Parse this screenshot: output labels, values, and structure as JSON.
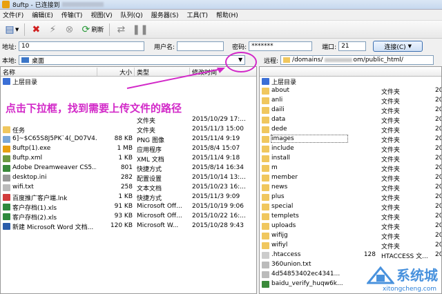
{
  "window": {
    "title": "8uftp - 已连接到 "
  },
  "menu": [
    "文件(F)",
    "编辑(E)",
    "传输(T)",
    "视图(V)",
    "队列(Q)",
    "服务器(S)",
    "工具(T)",
    "帮助(H)"
  ],
  "toolbar": {
    "refresh_label": "刷新"
  },
  "connection": {
    "address_label": "地址:",
    "address_value": "10",
    "user_label": "用户名:",
    "user_value": "",
    "password_label": "密码:",
    "password_value": "*******",
    "port_label": "端口:",
    "port_value": "21",
    "connect_label": "连接(C)"
  },
  "local": {
    "label": "本地:",
    "path": "桌面",
    "columns": [
      "名称",
      "大小",
      "类型",
      "修改时间"
    ],
    "rows": [
      {
        "name": "上层目录",
        "size": "",
        "type": "",
        "date": "",
        "icon": "up-icon",
        "color": "#3b6fd6"
      },
      {
        "name": "",
        "size": "",
        "type": "",
        "date": "",
        "icon": "",
        "color": ""
      },
      {
        "name": "",
        "size": "",
        "type": "",
        "date": "",
        "icon": "",
        "color": ""
      },
      {
        "name": "",
        "size": "",
        "type": "",
        "date": "",
        "icon": "",
        "color": ""
      },
      {
        "name": "",
        "size": "",
        "type": "文件夹",
        "date": "2015/10/29 17:...",
        "icon": "",
        "color": ""
      },
      {
        "name": "任务",
        "size": "",
        "type": "文件夹",
        "date": "2015/11/3 15:00",
        "icon": "folder-icon",
        "color": "#f0c75e"
      },
      {
        "name": "6]~$C65S8J5PK`4(_D07V4...",
        "size": "88 KB",
        "type": "PNG 图像",
        "date": "2015/11/4 9:19",
        "icon": "image-icon",
        "color": "#7aa7d8"
      },
      {
        "name": "8uftp(1).exe",
        "size": "1 MB",
        "type": "应用程序",
        "date": "2015/8/4 15:07",
        "icon": "exe-icon",
        "color": "#e8a010"
      },
      {
        "name": "8uftp.xml",
        "size": "1 KB",
        "type": "XML 文档",
        "date": "2015/11/4 9:18",
        "icon": "xml-icon",
        "color": "#6d9a40"
      },
      {
        "name": "Adobe Dreamweaver CS5...",
        "size": "801",
        "type": "快捷方式",
        "date": "2015/8/14 16:34",
        "icon": "dw-icon",
        "color": "#3a8a3a"
      },
      {
        "name": "desktop.ini",
        "size": "282",
        "type": "配置设置",
        "date": "2015/10/14 13:...",
        "icon": "ini-icon",
        "color": "#999999"
      },
      {
        "name": "wifi.txt",
        "size": "258",
        "type": "文本文档",
        "date": "2015/10/23 16:...",
        "icon": "txt-icon",
        "color": "#bbbbbb"
      },
      {
        "name": "百度推广客户端.lnk",
        "size": "1 KB",
        "type": "快捷方式",
        "date": "2015/11/3 9:09",
        "icon": "baidu-icon",
        "color": "#d23b3b"
      },
      {
        "name": "客户存档(1).xls",
        "size": "91 KB",
        "type": "Microsoft Off...",
        "date": "2015/10/19 9:06",
        "icon": "xls-icon",
        "color": "#2f8a3e"
      },
      {
        "name": "客户存档(2).xls",
        "size": "93 KB",
        "type": "Microsoft Off...",
        "date": "2015/10/22 16:...",
        "icon": "xls-icon",
        "color": "#2f8a3e"
      },
      {
        "name": "新建 Microsoft Word 文档...",
        "size": "120 KB",
        "type": "Microsoft W...",
        "date": "2015/10/28 9:43",
        "icon": "doc-icon",
        "color": "#2a5caa"
      }
    ]
  },
  "remote": {
    "label": "远程:",
    "path": "/domains/",
    "path_tail": "om/public_html/",
    "rows": [
      {
        "name": "上层目录",
        "size": "",
        "type": "",
        "icon": "up-icon",
        "color": "#3b6fd6"
      },
      {
        "name": "about",
        "size": "",
        "type": "文件夹",
        "icon": "folder-icon",
        "color": "#f0c75e"
      },
      {
        "name": "anli",
        "size": "",
        "type": "文件夹",
        "icon": "folder-icon",
        "color": "#f0c75e"
      },
      {
        "name": "daili",
        "size": "",
        "type": "文件夹",
        "icon": "folder-icon",
        "color": "#f0c75e"
      },
      {
        "name": "data",
        "size": "",
        "type": "文件夹",
        "icon": "folder-icon",
        "color": "#f0c75e"
      },
      {
        "name": "dede",
        "size": "",
        "type": "文件夹",
        "icon": "folder-icon",
        "color": "#f0c75e"
      },
      {
        "name": "images",
        "size": "",
        "type": "文件夹",
        "icon": "folder-icon",
        "color": "#f0c75e"
      },
      {
        "name": "include",
        "size": "",
        "type": "文件夹",
        "icon": "folder-icon",
        "color": "#f0c75e"
      },
      {
        "name": "install",
        "size": "",
        "type": "文件夹",
        "icon": "folder-icon",
        "color": "#f0c75e"
      },
      {
        "name": "m",
        "size": "",
        "type": "文件夹",
        "icon": "folder-icon",
        "color": "#f0c75e"
      },
      {
        "name": "member",
        "size": "",
        "type": "文件夹",
        "icon": "folder-icon",
        "color": "#f0c75e"
      },
      {
        "name": "news",
        "size": "",
        "type": "文件夹",
        "icon": "folder-icon",
        "color": "#f0c75e"
      },
      {
        "name": "plus",
        "size": "",
        "type": "文件夹",
        "icon": "folder-icon",
        "color": "#f0c75e"
      },
      {
        "name": "special",
        "size": "",
        "type": "文件夹",
        "icon": "folder-icon",
        "color": "#f0c75e"
      },
      {
        "name": "templets",
        "size": "",
        "type": "文件夹",
        "icon": "folder-icon",
        "color": "#f0c75e"
      },
      {
        "name": "uploads",
        "size": "",
        "type": "文件夹",
        "icon": "folder-icon",
        "color": "#f0c75e"
      },
      {
        "name": "wifijg",
        "size": "",
        "type": "文件夹",
        "icon": "folder-icon",
        "color": "#f0c75e"
      },
      {
        "name": "wifiyl",
        "size": "",
        "type": "文件夹",
        "icon": "folder-icon",
        "color": "#f0c75e"
      },
      {
        "name": ".htaccess",
        "size": "128",
        "type": "HTACCESS 文...",
        "icon": "file-icon",
        "color": "#cccccc"
      },
      {
        "name": "360union.txt",
        "size": "",
        "type": "",
        "icon": "txt-icon",
        "color": "#bbbbbb"
      },
      {
        "name": "4d54853402ec4341...",
        "size": "",
        "type": "",
        "icon": "txt-icon",
        "color": "#bbbbbb"
      },
      {
        "name": "baidu_verify_huqw6k...",
        "size": "",
        "type": "",
        "icon": "html-icon",
        "color": "#3a8a3a"
      }
    ],
    "date_col": [
      "",
      "20",
      "20",
      "20",
      "20",
      "20",
      "20",
      "20",
      "20",
      "20",
      "20",
      "20",
      "20",
      "20",
      "20",
      "20",
      "20",
      "20",
      "20",
      "",
      "",
      ""
    ]
  },
  "annotation": {
    "text": "点击下拉框，找到需要上传文件的路径",
    "color": "#d228c8"
  },
  "watermark": {
    "text": "系统城",
    "sub": "xitongcheng.com"
  }
}
